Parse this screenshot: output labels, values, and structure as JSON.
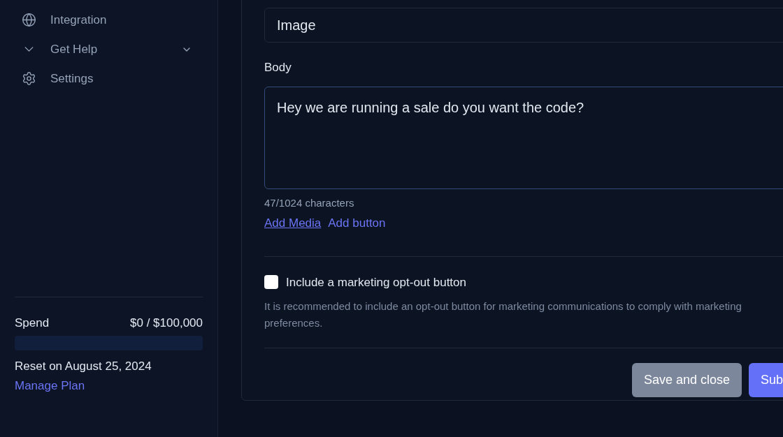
{
  "sidebar": {
    "items": [
      {
        "label": "Integration",
        "kind": "globe",
        "expandable": false
      },
      {
        "label": "Get Help",
        "kind": "chevron",
        "expandable": true
      },
      {
        "label": "Settings",
        "kind": "gear",
        "expandable": false
      }
    ],
    "spend": {
      "label": "Spend",
      "amount": "$0 / $100,000",
      "level": 0,
      "reset": "Reset on August 25, 2024",
      "link": "Manage Plan"
    }
  },
  "form": {
    "header_value": "Image",
    "body_label": "Body",
    "body_value": "Hey we are running a sale do you want the code?",
    "counter": "47/1024 characters",
    "links": [
      "Add Media",
      "Add button"
    ],
    "opt_out": {
      "label": "Include a marketing opt-out button",
      "checked": false,
      "hint": "It is recommended to include an opt-out button for marketing communications to comply with marketing preferences."
    },
    "buttons": [
      {
        "label": "Save and close",
        "kind": "secondary"
      },
      {
        "label": "Sub",
        "kind": "primary"
      }
    ]
  }
}
